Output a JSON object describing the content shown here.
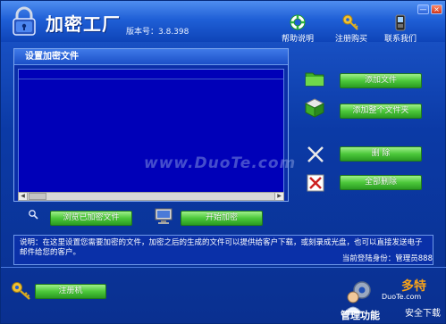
{
  "app": {
    "title": "加密工厂",
    "version_label": "版本号：3.8.398"
  },
  "window_controls": {
    "minimize": "—",
    "close": "×"
  },
  "top_links": {
    "help": "帮助说明",
    "register": "注册购买",
    "contact": "联系我们"
  },
  "panel": {
    "title": "设置加密文件"
  },
  "buttons": {
    "add_file": "添加文件",
    "add_folder": "添加整个文件夹",
    "delete": "删 除",
    "delete_all": "全部删除",
    "browse": "浏览已加密文件",
    "start": "开始加密",
    "register": "注册机"
  },
  "info": {
    "text": "说明：在这里设置您需要加密的文件，加密之后的生成的文件可以提供给客户下载，或刻录成光盘，也可以直接发送电子邮件给您的客户。",
    "login_status": "当前登陆身份：管理员888"
  },
  "bottom": {
    "management_label": "管理功能"
  },
  "watermark": "www.DuoTe.com",
  "corner_logo": {
    "brand": "多特",
    "sub": "DuoTe.com",
    "tagline": "安全下载"
  },
  "colors": {
    "window_blue": "#0b3aa6",
    "list_blue": "#0000b8",
    "button_green": "#4cc83a"
  }
}
